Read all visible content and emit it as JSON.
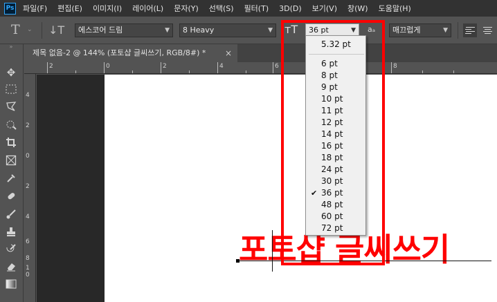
{
  "menu": {
    "logo": "Ps",
    "items": [
      "파일(F)",
      "편집(E)",
      "이미지(I)",
      "레이어(L)",
      "문자(Y)",
      "선택(S)",
      "필터(T)",
      "3D(D)",
      "보기(V)",
      "창(W)",
      "도움말(H)"
    ]
  },
  "options": {
    "font_family": "에스코어 드림",
    "font_style": "8 Heavy",
    "font_size": "36 pt",
    "aa_icon": "aₐ",
    "anti_alias": "매끄럽게"
  },
  "document": {
    "tab_title": "제목 없음-2 @ 144% (포토샵 글씨쓰기, RGB/8#) *",
    "close_glyph": "×",
    "canvas_text": "포토샵 글씨쓰기"
  },
  "ruler": {
    "h_labels": [
      "2",
      "0",
      "2",
      "4",
      "6",
      "8"
    ],
    "v_labels": [
      "4",
      "2",
      "0",
      "2",
      "4",
      "6",
      "8",
      "1",
      "0"
    ]
  },
  "size_menu": {
    "top_item": "5.32 pt",
    "items": [
      "6 pt",
      "8 pt",
      "9 pt",
      "10 pt",
      "11 pt",
      "12 pt",
      "14 pt",
      "16 pt",
      "18 pt",
      "24 pt",
      "30 pt",
      "36 pt",
      "48 pt",
      "60 pt",
      "72 pt"
    ],
    "checked": "36 pt",
    "check_glyph": "✔"
  },
  "colors": {
    "highlight": "#ff0000",
    "canvas_text": "#ff0000"
  }
}
